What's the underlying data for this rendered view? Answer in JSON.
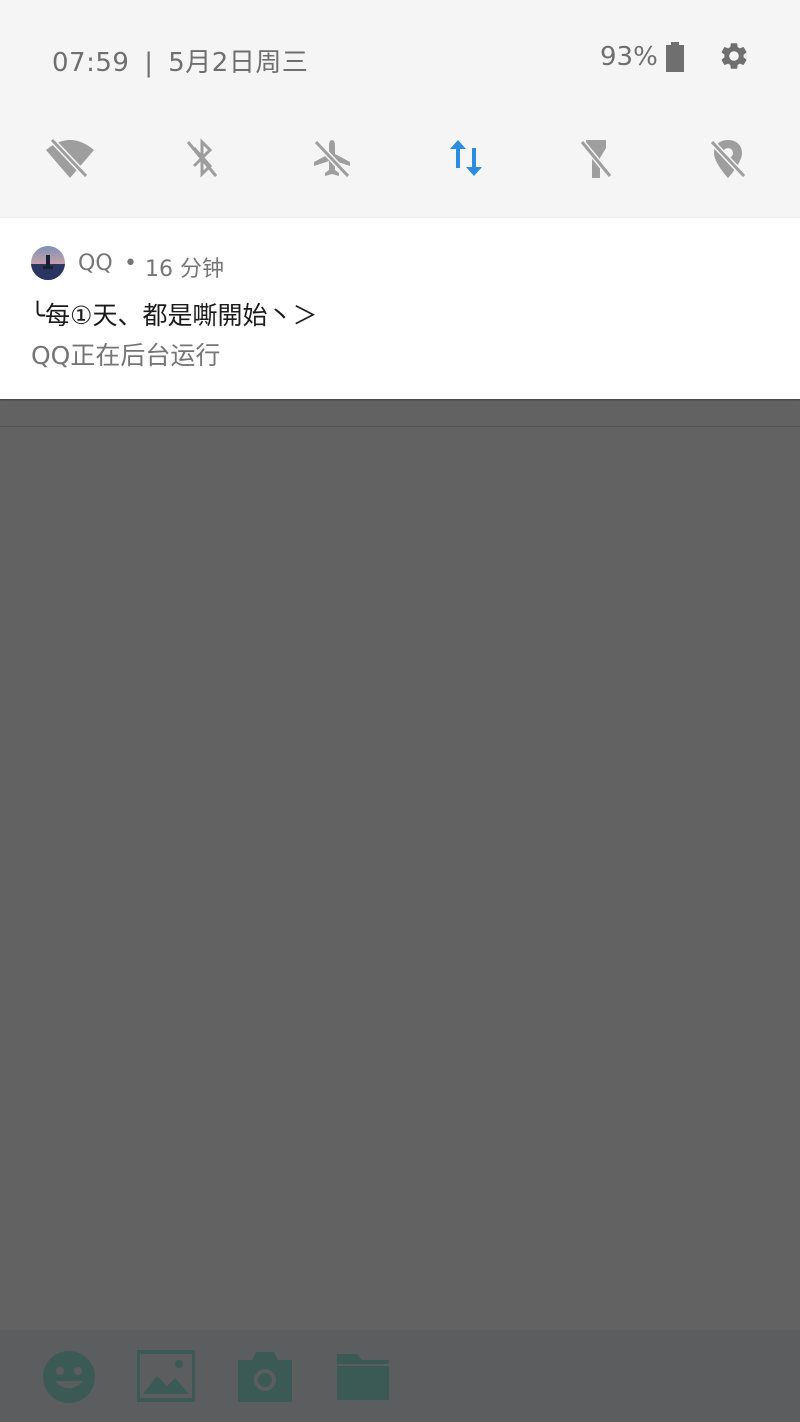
{
  "status": {
    "time": "07:59",
    "separator": "|",
    "date": "5月2日周三",
    "battery_percent": "93%",
    "battery_level": 0.93
  },
  "quick_tiles": [
    {
      "name": "wifi-off-icon",
      "active": false
    },
    {
      "name": "bluetooth-off-icon",
      "active": false
    },
    {
      "name": "airplane-off-icon",
      "active": false
    },
    {
      "name": "mobile-data-icon",
      "active": true
    },
    {
      "name": "flashlight-off-icon",
      "active": false
    },
    {
      "name": "location-off-icon",
      "active": false
    }
  ],
  "colors": {
    "tile_inactive": "#9e9e9e",
    "tile_active": "#2b8de0",
    "dimmed_icon": "#3c5a55"
  },
  "notification": {
    "app_name": "QQ",
    "bullet": "•",
    "time_ago": "16 分钟",
    "title": "╰每①天、都是嘶開始丶＞",
    "text": "QQ正在后台运行"
  },
  "bottom_toolbar": [
    {
      "name": "emoji-icon"
    },
    {
      "name": "image-icon"
    },
    {
      "name": "camera-icon"
    },
    {
      "name": "folder-icon"
    }
  ]
}
